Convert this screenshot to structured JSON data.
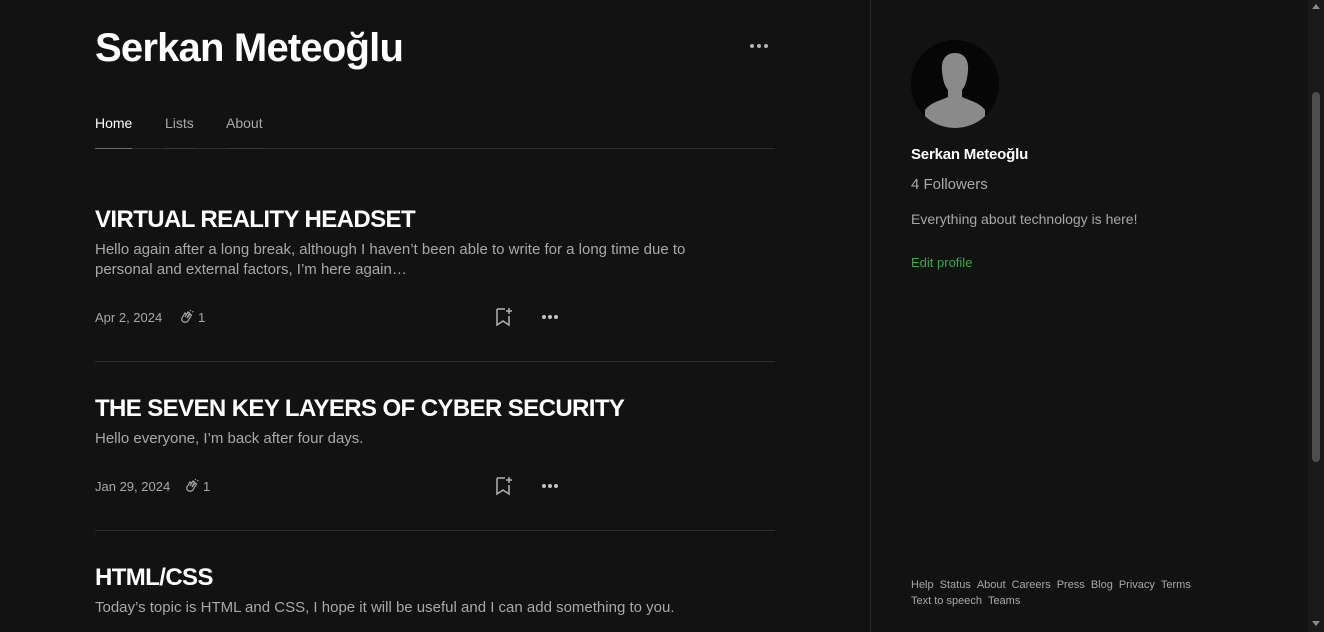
{
  "profile": {
    "name": "Serkan Meteoğlu",
    "more_icon": "more-horizontal-icon"
  },
  "tabs": [
    {
      "label": "Home",
      "active": true
    },
    {
      "label": "Lists",
      "active": false
    },
    {
      "label": "About",
      "active": false
    }
  ],
  "posts": [
    {
      "title": "VIRTUAL REALITY HEADSET",
      "excerpt": "Hello again after a long break, although I haven’t been able to write for a long time due to personal and external factors, I’m here again…",
      "date": "Apr 2, 2024",
      "claps": "1"
    },
    {
      "title": "THE SEVEN KEY LAYERS OF CYBER SECURITY",
      "excerpt": "Hello everyone, I’m back after four days.",
      "date": "Jan 29, 2024",
      "claps": "1"
    },
    {
      "title": "HTML/CSS",
      "excerpt": "Today’s topic is HTML and CSS, I hope it will be useful and I can add something to you."
    }
  ],
  "sidebar": {
    "name": "Serkan Meteoğlu",
    "followers": "4 Followers",
    "bio": "Everything about technology is here!",
    "edit_profile": "Edit profile",
    "footer_links": [
      "Help",
      "Status",
      "About",
      "Careers",
      "Press",
      "Blog",
      "Privacy",
      "Terms",
      "Text to speech",
      "Teams"
    ]
  },
  "colors": {
    "background": "#121212",
    "accent_green": "#35a84a",
    "text_primary": "#ffffff",
    "text_secondary": "#a8a8a8"
  }
}
